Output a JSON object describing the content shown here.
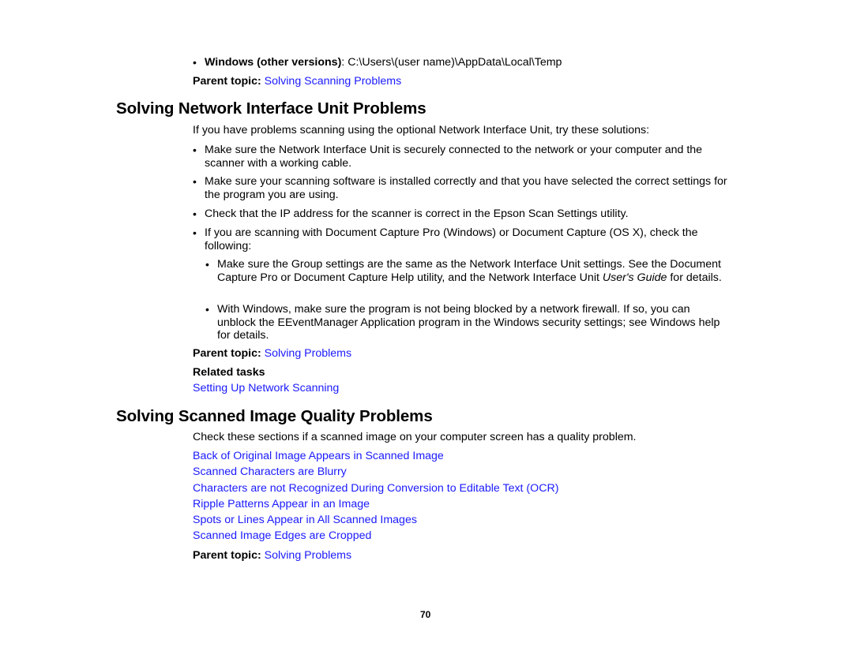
{
  "top": {
    "bullet_label": "Windows (other versions)",
    "bullet_sep": ":",
    "bullet_path": " C:\\Users\\(user name)\\AppData\\Local\\Temp",
    "parent_label": "Parent topic:",
    "parent_link": "Solving Scanning Problems"
  },
  "section1": {
    "title": "Solving Network Interface Unit Problems",
    "intro": "If you have problems scanning using the optional Network Interface Unit, try these solutions:",
    "bullets": [
      "Make sure the Network Interface Unit is securely connected to the network or your computer and the scanner with a working cable.",
      "Make sure your scanning software is installed correctly and that you have selected the correct settings for the program you are using.",
      "Check that the IP address for the scanner is correct in the Epson Scan Settings utility.",
      "If you are scanning with Document Capture Pro (Windows) or Document Capture (OS X), check the following:"
    ],
    "sub_bullets": {
      "item1_pre": "Make sure the Group settings are the same as the Network Interface Unit settings. See the Document Capture Pro or Document Capture Help utility, and the Network Interface Unit ",
      "item1_italic": "User's Guide",
      "item1_post": " for details.",
      "item2": "With Windows, make sure the program is not being blocked by a network firewall. If so, you can unblock the EEventManager Application program in the Windows security settings; see Windows help for details."
    },
    "parent_label": "Parent topic:",
    "parent_link": "Solving Problems",
    "related_label": "Related tasks",
    "related_link": "Setting Up Network Scanning"
  },
  "section2": {
    "title": "Solving Scanned Image Quality Problems",
    "intro": "Check these sections if a scanned image on your computer screen has a quality problem.",
    "links": [
      "Back of Original Image Appears in Scanned Image",
      "Scanned Characters are Blurry",
      "Characters are not Recognized During Conversion to Editable Text (OCR)",
      "Ripple Patterns Appear in an Image",
      "Spots or Lines Appear in All Scanned Images",
      "Scanned Image Edges are Cropped"
    ],
    "parent_label": "Parent topic:",
    "parent_link": "Solving Problems"
  },
  "footer": {
    "page_number": "70"
  },
  "colors": {
    "link": "#1a1aff",
    "text": "#000000"
  }
}
